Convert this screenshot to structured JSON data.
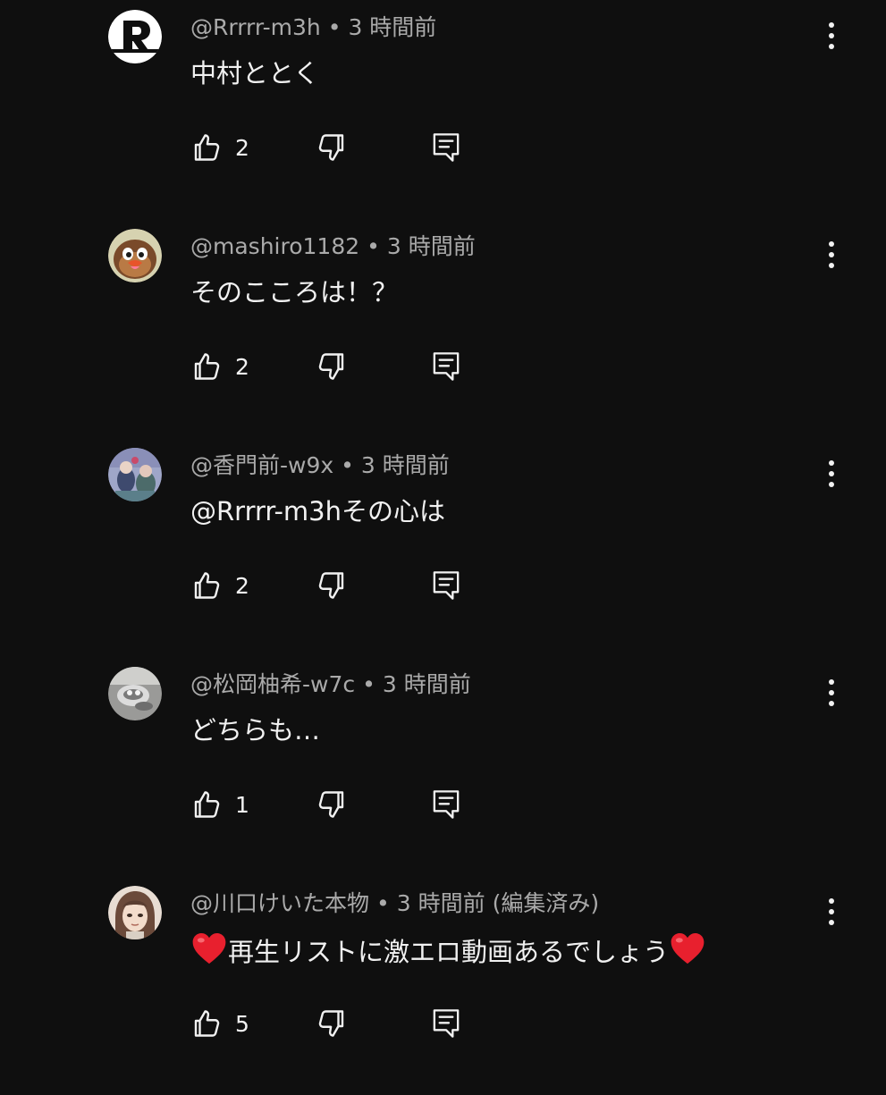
{
  "theme": {
    "background": "#0f0f0f",
    "text_primary": "#f1f1f1",
    "text_secondary": "#aaaaaa",
    "icon_color": "#f1f1f1"
  },
  "comments": [
    {
      "author": "@Rrrrr-m3h",
      "separator": "•",
      "time": "3 時間前",
      "text": "中村ととく",
      "likes": "2",
      "avatar": "letter-r-logo"
    },
    {
      "author": "@mashiro1182",
      "separator": "•",
      "time": "3 時間前",
      "text": "そのこころは！？",
      "likes": "2",
      "avatar": "bird-character"
    },
    {
      "author": "@香門前-w9x",
      "separator": "•",
      "time": "3 時間前",
      "text": "@Rrrrr-m3hその心は",
      "likes": "2",
      "avatar": "anime-illustration"
    },
    {
      "author": "@松岡柚希-w7c",
      "separator": "•",
      "time": "3 時間前",
      "text": "どちらも…",
      "likes": "1",
      "avatar": "silver-object-photo"
    },
    {
      "author": "@川口けいた本物",
      "separator": "•",
      "time": "3 時間前 (編集済み)",
      "text": "再生リストに激エロ動画あるでしょう",
      "likes": "5",
      "avatar": "anime-face",
      "emoji": "red-heart"
    }
  ]
}
